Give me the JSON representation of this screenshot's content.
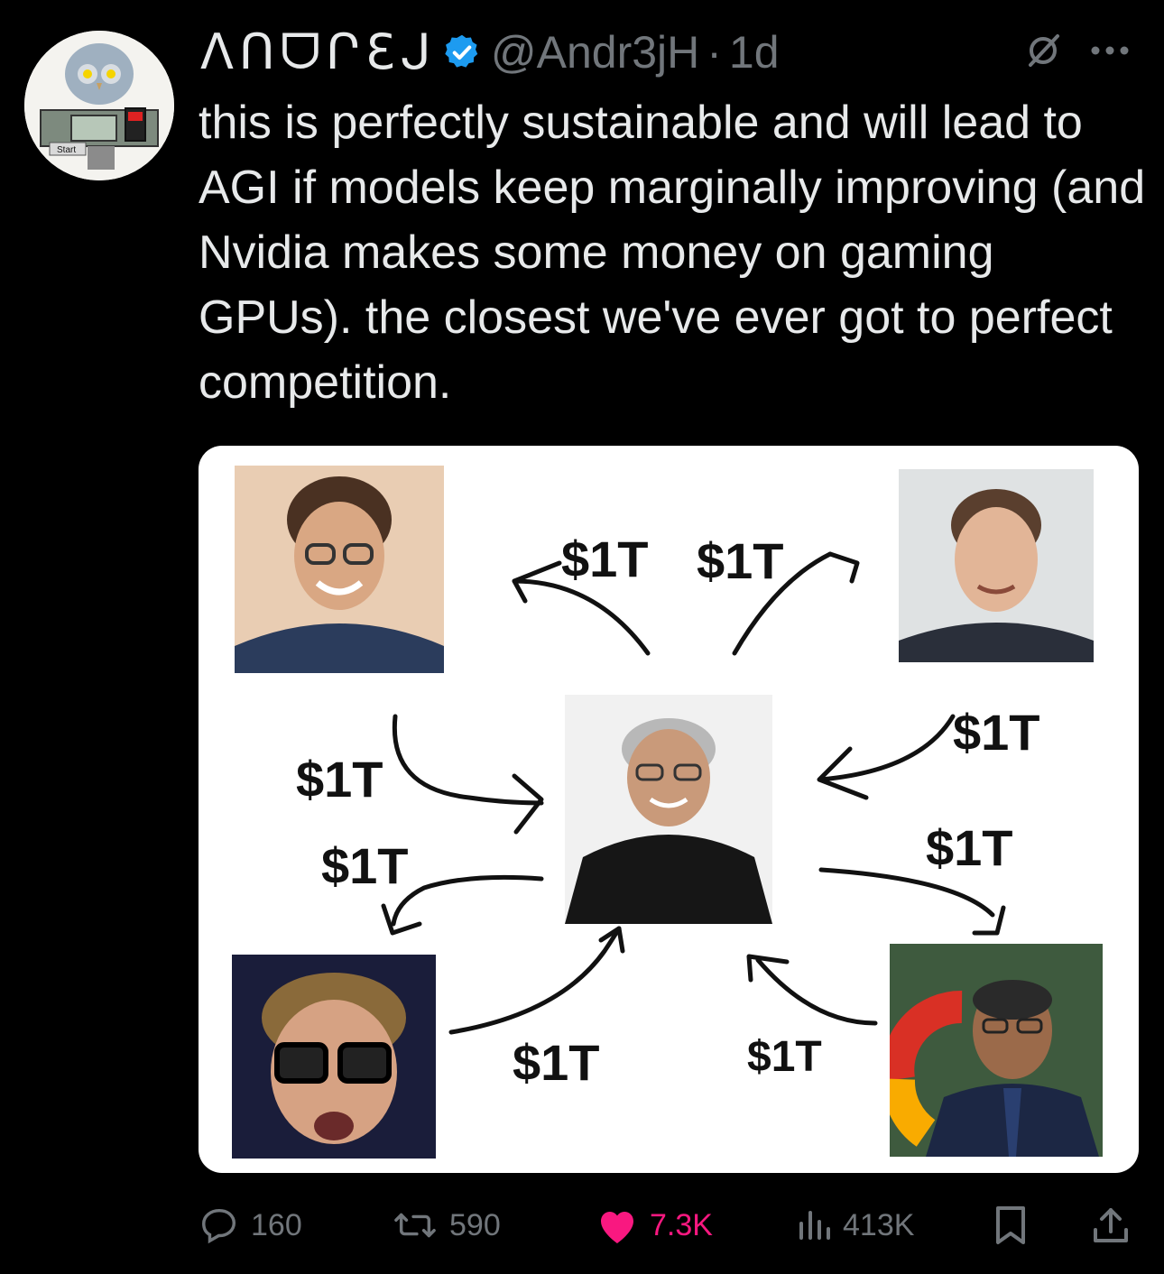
{
  "tweet": {
    "display_name": "ΛՈᗜՐƐᒍ",
    "handle": "@Andr3jH",
    "separator": "·",
    "time": "1d",
    "text": "this is perfectly sustainable and will lead to AGI if models keep marginally improving (and Nvidia makes some money on gaming GPUs). the closest we've ever got to perfect competition.",
    "avatar_badge": "Start"
  },
  "media": {
    "labels": {
      "top_left": "$1T",
      "top_right": "$1T",
      "right_top": "$1T",
      "left_top": "$1T",
      "left_bottom": "$1T",
      "right_bottom": "$1T",
      "bottom_left": "$1T",
      "bottom_right": "$1T"
    }
  },
  "actions": {
    "replies": "160",
    "reposts": "590",
    "likes": "7.3K",
    "views": "413K"
  },
  "colors": {
    "background": "#000000",
    "text": "#e7e9ea",
    "muted": "#71767b",
    "verified": "#1d9bf0",
    "like": "#f91880"
  },
  "icons": [
    "mute-icon",
    "more-icon",
    "verified-icon",
    "reply-icon",
    "repost-icon",
    "heart-icon",
    "views-icon",
    "bookmark-icon",
    "share-icon"
  ]
}
